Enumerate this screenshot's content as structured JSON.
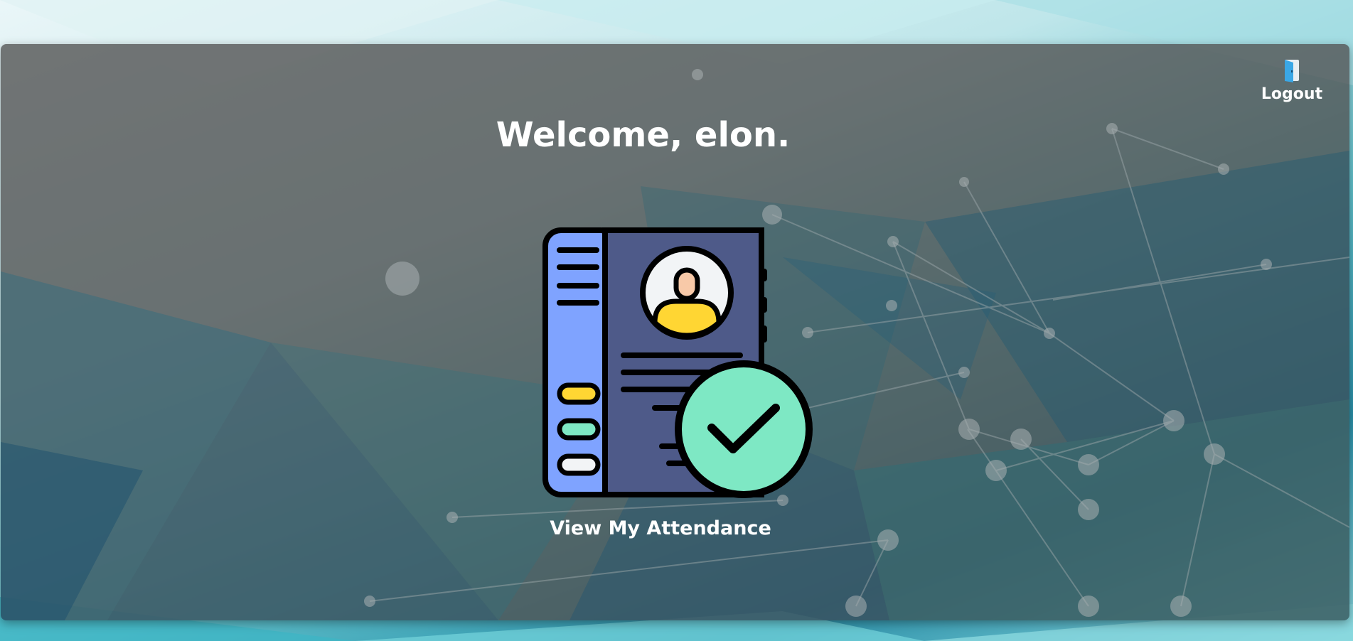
{
  "header": {
    "welcome_text": "Welcome, elon.",
    "logout_label": "Logout",
    "logout_icon": "door-exit-icon"
  },
  "main": {
    "card": {
      "label": "View My Attendance",
      "icon": "attendance-checklist-icon"
    }
  },
  "colors": {
    "panel_overlay": "#505050",
    "text": "#ffffff",
    "book_spine": "#7fa3ff",
    "book_cover": "#4e5a89",
    "check_circle": "#7ee8c4",
    "avatar_body": "#ffd633",
    "avatar_face": "#f8c9a8"
  }
}
